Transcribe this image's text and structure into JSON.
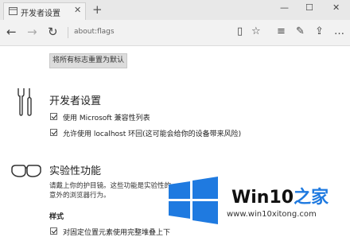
{
  "tab": {
    "title": "开发者设置",
    "close": "✕",
    "new_tab": "+"
  },
  "window": {
    "minimize": "—",
    "maximize": "☐",
    "close": "✕"
  },
  "nav": {
    "back": "←",
    "forward": "→",
    "refresh": "↻",
    "address": "about:flags"
  },
  "toolbar": {
    "reading_view": "▯",
    "favorite": "☆",
    "hub": "≡",
    "note": "✎",
    "share": "⇪",
    "more": "…"
  },
  "reset_button": "将所有标志重置为默认",
  "developer": {
    "title": "开发者设置",
    "options": [
      {
        "label": "使用 Microsoft 兼容性列表",
        "checked": true
      },
      {
        "label": "允许使用 localhost 环回(这可能会给你的设备带来风险)",
        "checked": true
      }
    ]
  },
  "experimental": {
    "title": "实验性功能",
    "description_line1": "请戴上你的护目镜。这些功能是实验性的",
    "description_line2": "意外的浏览器行为。",
    "style_heading": "样式",
    "option": {
      "label": "对固定位置元素使用完整堆叠上下",
      "checked": true
    }
  },
  "watermark": {
    "title_part1": "Win10",
    "title_part2": "之家",
    "url": "www.win10xitong.com",
    "accent_color": "#1f7ae0"
  }
}
